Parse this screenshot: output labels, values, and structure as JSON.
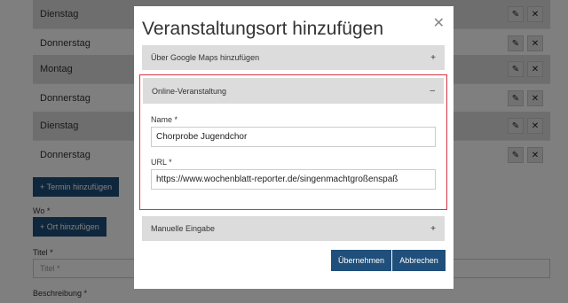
{
  "background": {
    "rows": [
      {
        "label": "Dienstag"
      },
      {
        "label": "Donnerstag"
      },
      {
        "label": "Montag"
      },
      {
        "label": "Donnerstag"
      },
      {
        "label": "Dienstag"
      },
      {
        "label": "Donnerstag"
      }
    ],
    "add_date_button": "+ Termin hinzufügen",
    "where_label": "Wo *",
    "add_place_button": "+ Ort hinzufügen",
    "title_label": "Titel *",
    "title_placeholder": "Titel *",
    "description_label": "Beschreibung *",
    "edit_icon": "✎",
    "delete_icon": "✕"
  },
  "modal": {
    "title": "Veranstaltungsort hinzufügen",
    "close_icon": "✕",
    "sections": {
      "google_maps": {
        "label": "Über Google Maps hinzufügen",
        "sign": "+"
      },
      "online": {
        "label": "Online-Veranstaltung",
        "sign": "–"
      },
      "manual": {
        "label": "Manuelle Eingabe",
        "sign": "+"
      }
    },
    "name_label": "Name *",
    "name_value": "Chorprobe Jugendchor",
    "url_label": "URL *",
    "url_value": "https://www.wochenblatt-reporter.de/singenmachtgroßenspaß",
    "submit_button": "Übernehmen",
    "cancel_button": "Abbrechen"
  },
  "colors": {
    "primary": "#1f4f7a",
    "highlight_border": "#d9343f",
    "section_bg": "#dcdcdc"
  }
}
